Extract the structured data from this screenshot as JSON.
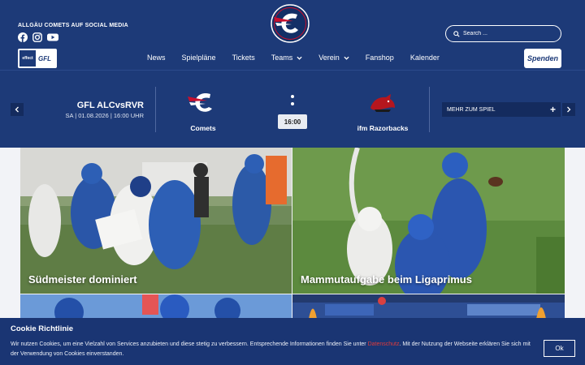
{
  "header": {
    "social_label": "ALLGÄU COMETS AUF SOCIAL MEDIA",
    "social_icons": [
      "facebook-icon",
      "instagram-icon",
      "youtube-icon"
    ],
    "search_placeholder": "Search ...",
    "sponsor_logo_text": "effect",
    "sponsor_logo_gfl": "GFL",
    "donate_label": "Spenden",
    "nav": [
      {
        "label": "News",
        "dropdown": false
      },
      {
        "label": "Spielpläne",
        "dropdown": false
      },
      {
        "label": "Tickets",
        "dropdown": false
      },
      {
        "label": "Teams",
        "dropdown": true
      },
      {
        "label": "Verein",
        "dropdown": true
      },
      {
        "label": "Fanshop",
        "dropdown": false
      },
      {
        "label": "Kalender",
        "dropdown": false
      }
    ]
  },
  "gamebar": {
    "prev_icon": "chevron-left-icon",
    "next_icon": "chevron-right-icon",
    "title": "GFL ALCvsRVR",
    "date": "SA | 01.08.2026 | 16:00 UHR",
    "home_team": "Comets",
    "away_team": "ifm Razorbacks",
    "time": "16:00",
    "more_label": "MEHR ZUM SPIEL",
    "more_icon": "plus-icon"
  },
  "news": [
    {
      "title": "Südmeister dominiert"
    },
    {
      "title": "Mammutaufgabe beim Ligaprimus"
    }
  ],
  "cookie": {
    "title": "Cookie Richtlinie",
    "text_before": "Wir nutzen Cookies, um eine Vielzahl von Services anzubieten und diese stetig zu verbessern. Entsprechende Informationen finden Sie unter ",
    "link": "Datenschutz",
    "text_after": ". Mit der Nutzung der Webseite erklären Sie sich mit der Verwendung von Cookies einverstanden.",
    "ok_label": "Ok"
  },
  "colors": {
    "brand": "#1d3a78",
    "brand_dark": "#142b5e",
    "link": "#e03b3b"
  }
}
